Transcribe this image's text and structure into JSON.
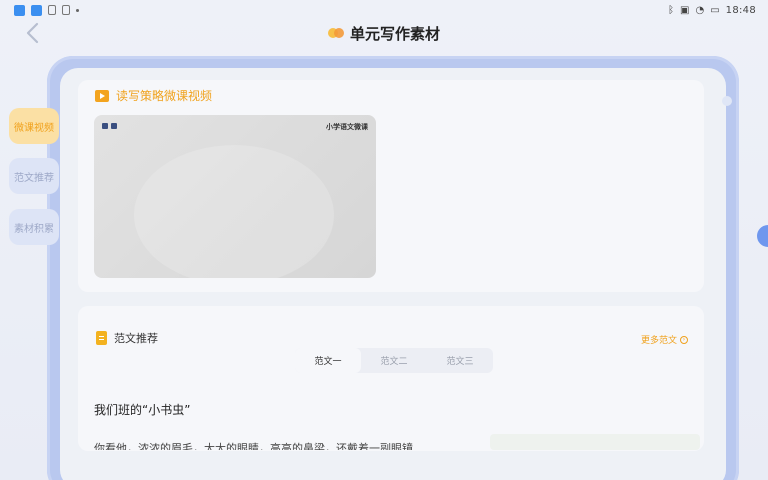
{
  "status_bar": {
    "time": "18:48"
  },
  "header": {
    "title": "单元写作素材"
  },
  "side_tabs": [
    {
      "label": "微课视频"
    },
    {
      "label": "范文推荐"
    },
    {
      "label": "素材积累"
    }
  ],
  "video_section": {
    "title": "读写策略微课视频",
    "video_caption": "小学语文微课"
  },
  "essay_section": {
    "title": "范文推荐",
    "more_label": "更多范文",
    "tabs": [
      "范文一",
      "范文二",
      "范文三"
    ],
    "essay_title": "我们班的“小书虫”",
    "essay_first_line": "你看他，浓浓的眉毛，大大的眼睛，高高的鼻梁，还戴着一副眼镜"
  },
  "colors": {
    "accent": "#f0a21d",
    "frame": "#b9c8ef"
  }
}
